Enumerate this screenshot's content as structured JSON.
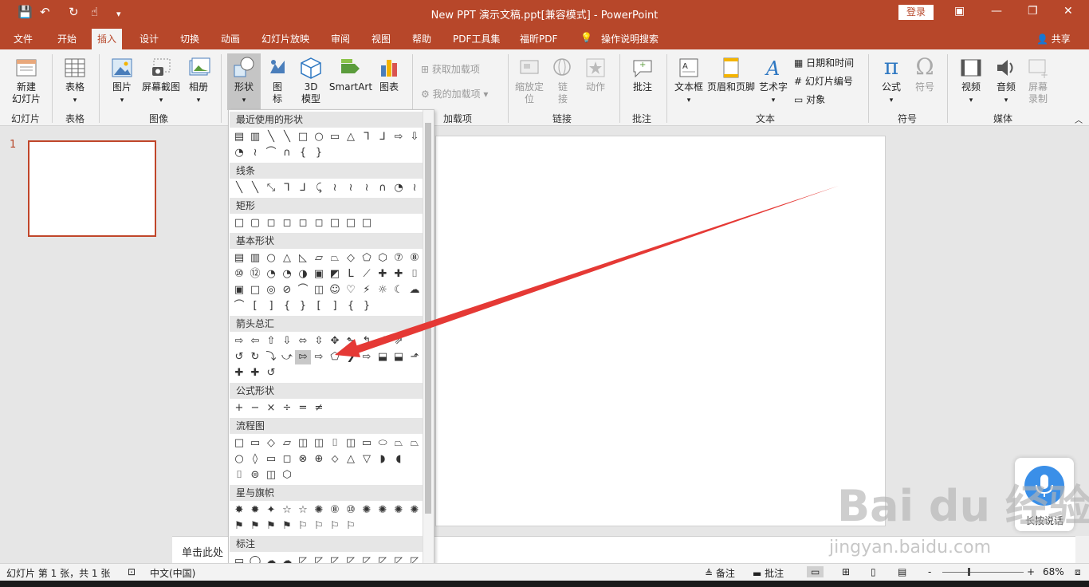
{
  "window": {
    "title": "New PPT 演示文稿.ppt[兼容模式] - PowerPoint",
    "login_label": "登录",
    "quick_access": [
      "save-icon",
      "undo-icon",
      "redo-icon",
      "touch-mode-icon",
      "customize-icon"
    ]
  },
  "tabs": [
    {
      "label": "文件"
    },
    {
      "label": "开始"
    },
    {
      "label": "插入"
    },
    {
      "label": "设计"
    },
    {
      "label": "切换"
    },
    {
      "label": "动画"
    },
    {
      "label": "幻灯片放映"
    },
    {
      "label": "审阅"
    },
    {
      "label": "视图"
    },
    {
      "label": "帮助"
    },
    {
      "label": "PDF工具集"
    },
    {
      "label": "福昕PDF"
    },
    {
      "label": "操作说明搜索"
    }
  ],
  "active_tab": "插入",
  "share_label": "共享",
  "ribbon": {
    "new_slide": "新建\n幻灯片",
    "table": "表格",
    "picture": "图片",
    "screenshot": "屏幕截图",
    "album": "相册",
    "shapes": "形状",
    "icons": "图\n标",
    "model3d": "3D\n模型",
    "smartart": "SmartArt",
    "chart": "图表",
    "get_addins": "获取加载项",
    "my_addins": "我的加载项",
    "zoom": "缩放定\n位",
    "link": "链\n接",
    "action": "动作",
    "comment": "批注",
    "textbox": "文本框",
    "header_footer": "页眉和页脚",
    "wordart": "艺术字",
    "date_time": "日期和时间",
    "slide_number": "幻灯片编号",
    "object": "对象",
    "equation": "公式",
    "symbol": "符号",
    "video": "视频",
    "audio": "音频",
    "screen_record": "屏幕\n录制",
    "groups": {
      "slides": "幻灯片",
      "tables": "表格",
      "images": "图像",
      "addins": "加载项",
      "links": "链接",
      "comments": "批注",
      "text": "文本",
      "symbols": "符号",
      "media": "媒体"
    }
  },
  "shapes_panel": {
    "categories": {
      "recent": "最近使用的形状",
      "lines": "线条",
      "rect": "矩形",
      "basic": "基本形状",
      "arrows": "箭头总汇",
      "equation": "公式形状",
      "flowchart": "流程图",
      "stars": "星与旗帜",
      "callouts": "标注"
    },
    "rows": {
      "recent1": "▤▥╲╲□○▭△⅂⅃⇨⇩",
      "recent2": "◔≀⌒∩{}",
      "lines1": "╲╲⤡⅂⅃⤹≀≀≀∩◔≀",
      "rect1": "□▢◻◻◻◻□□□",
      "basic1": "▤▥○△◺▱⏢◇⬠⬡⑦⑧",
      "basic2": "⑩⑫◔◔◑▣◩L⟋✚✚⌷",
      "basic3": "▣□◎⊘⌒◫☺♡⚡☼☾☁",
      "basic4": "⌒[]{}[]{}",
      "arrows1": "⇨⇦⇧⇩⬄⇳✥⬑↰↲⇗",
      "arrows2": "↺↻⤵⤻⇰⇨⬠❯⇨⬓⬓⬏",
      "arrows3": "✚✚↺",
      "equation1": "+−×÷=≠",
      "flow1": "□▭◇▱◫◫⌷◫▭⬭⏢⏢",
      "flow2": "○◊▭◻⊗⊕⬦△▽◗◖",
      "flow3": "⌷⊜◫⬡",
      "stars1": "✸✹✦☆☆✺⑧⑩✺✺✺✺",
      "stars2": "⚑⚑⚑⚑⚐⚐⚐⚐",
      "callouts1": "▭◯☁☁◸◸◸◸◸◸◸◸"
    }
  },
  "slide_panel": {
    "slide_number": "1"
  },
  "notes_placeholder": "单击此处",
  "status": {
    "slide_info": "幻灯片 第 1 张，共 1 张",
    "language": "中文(中国)",
    "notes": "备注",
    "comments": "批注",
    "zoom": "68%",
    "minus": "-",
    "plus": "+"
  },
  "voice_widget": {
    "label": "长按说话"
  },
  "watermark": {
    "logo": "Bai du 经验",
    "url": "jingyan.baidu.com"
  },
  "colors": {
    "accent": "#b7472a",
    "arrow": "#e53935",
    "ribbon_bg": "#f3f3f3"
  }
}
